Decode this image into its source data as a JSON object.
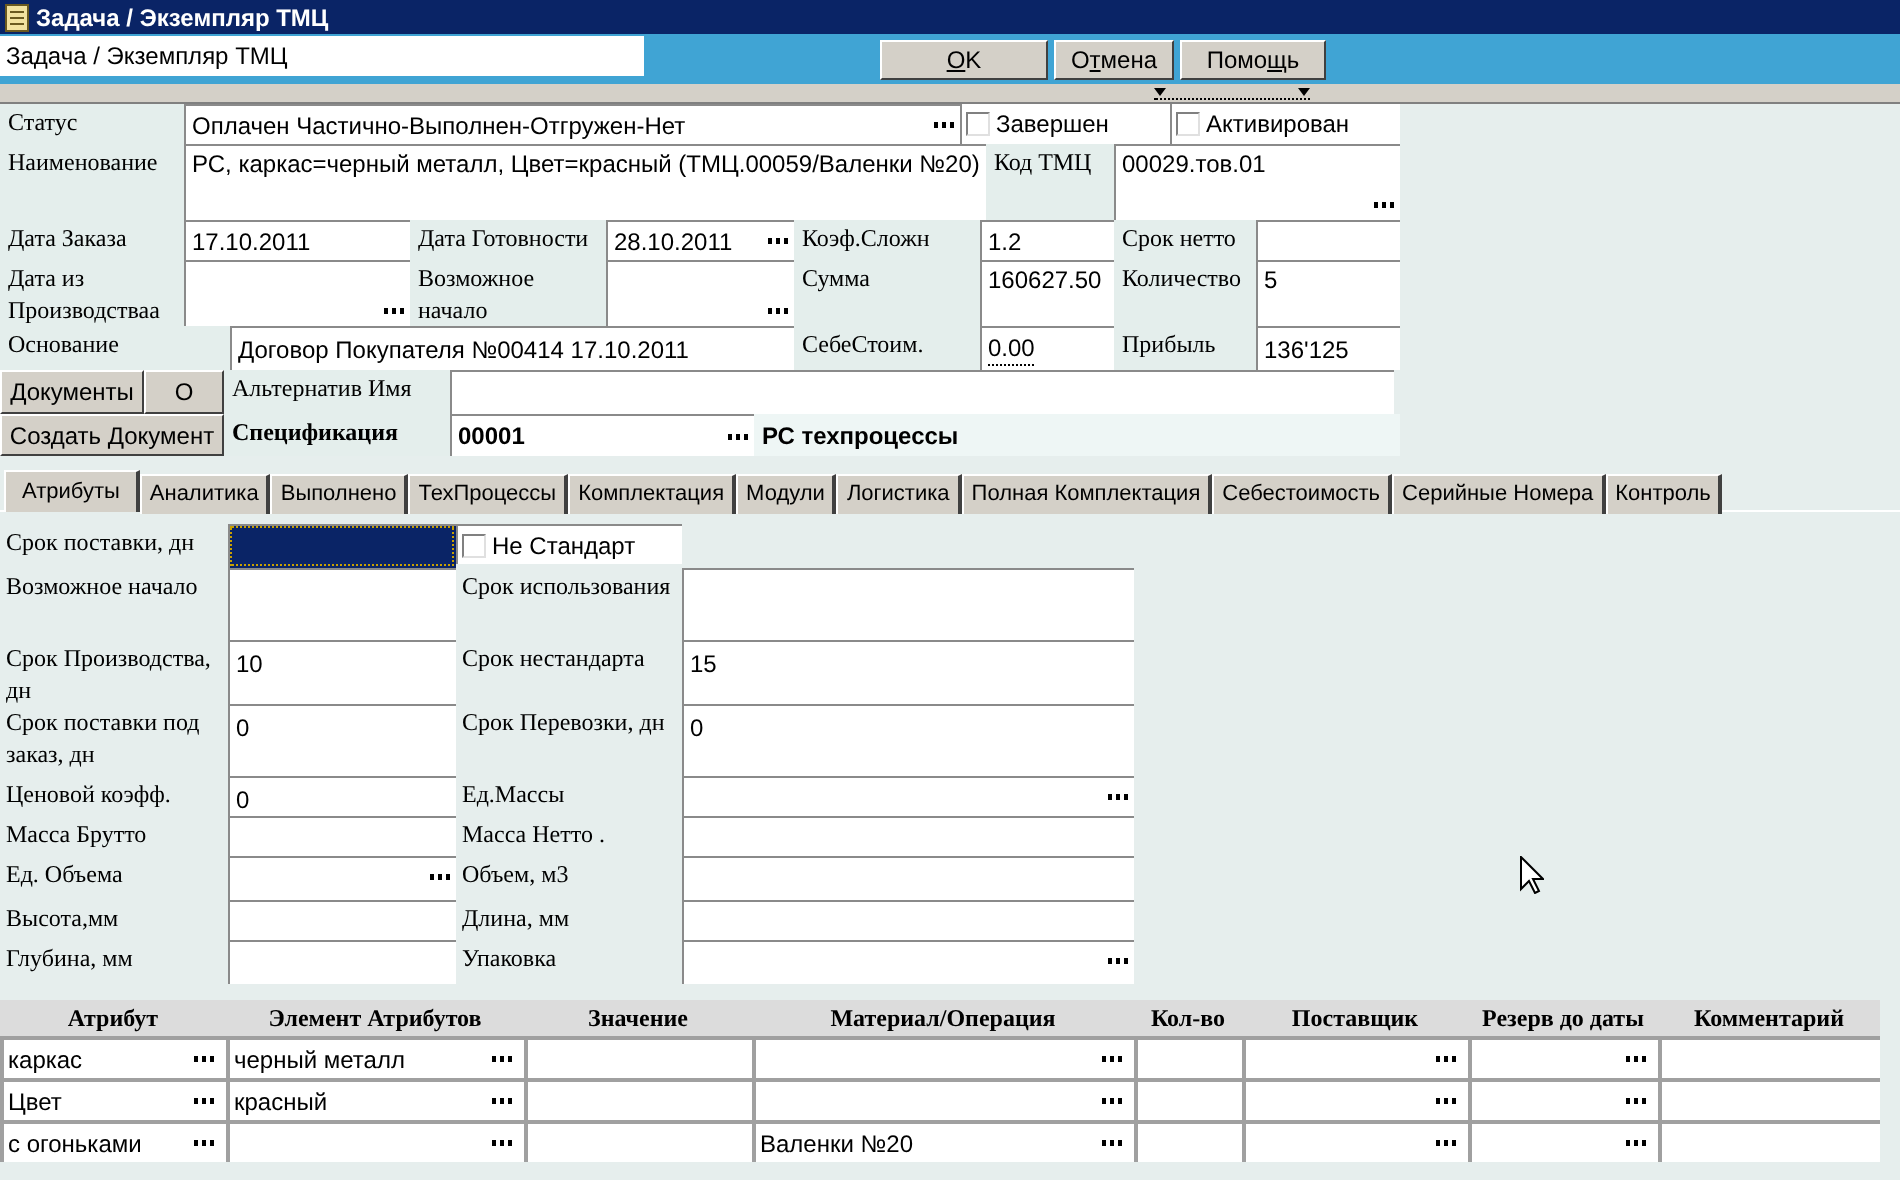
{
  "window": {
    "title": "Задача / Экземпляр ТМЦ"
  },
  "header_field": {
    "value": "Задача / Экземпляр ТМЦ"
  },
  "buttons": [
    {
      "key": "O",
      "post": "K"
    },
    {
      "pre": "О",
      "key": "т",
      "post": "мена"
    },
    {
      "pre": "Помо",
      "key": "щ",
      "post": "ь"
    }
  ],
  "form_rows": [
    {
      "cells": [
        {
          "kind": "label",
          "text": "Статус"
        },
        {
          "kind": "lookup",
          "value": "Оплачен Частично-Выполнен-Отгружен-Нет"
        },
        {
          "kind": "checkbox",
          "text": "Завершен",
          "checked": false
        },
        {
          "kind": "checkbox",
          "text": "Активирован",
          "checked": false
        }
      ]
    },
    {
      "cells": [
        {
          "kind": "label",
          "text": "Наименование"
        },
        {
          "kind": "field",
          "value": "РС, каркас=черный металл, Цвет=красный  (ТМЦ.00059/Валенки №20)"
        },
        {
          "kind": "label",
          "text": "Код ТМЦ"
        },
        {
          "kind": "lookup",
          "value": "00029.тов.01"
        }
      ]
    },
    {
      "cells": [
        {
          "kind": "label",
          "text": "Дата Заказа"
        },
        {
          "kind": "field",
          "value": "17.10.2011"
        },
        {
          "kind": "label",
          "text": "Дата Готовности"
        },
        {
          "kind": "lookup",
          "value": "28.10.2011"
        },
        {
          "kind": "label",
          "text": "Коэф.Сложн"
        },
        {
          "kind": "field",
          "value": "1.2"
        },
        {
          "kind": "label",
          "text": "Срок нетто"
        },
        {
          "kind": "field"
        }
      ]
    },
    {
      "cells": [
        {
          "kind": "label",
          "text": "Дата из Производстваа"
        },
        {
          "kind": "lookup"
        },
        {
          "kind": "label",
          "text": "Возможное начало"
        },
        {
          "kind": "lookup"
        },
        {
          "kind": "label",
          "text": "Сумма"
        },
        {
          "kind": "field",
          "value": "160627.50"
        },
        {
          "kind": "label",
          "text": "Количество"
        },
        {
          "kind": "field",
          "value": "5"
        }
      ]
    },
    {
      "cells": [
        {
          "kind": "label",
          "text": "Основание"
        },
        {
          "kind": "field",
          "value": "Договор Покупателя №00414 17.10.2011"
        },
        {
          "kind": "label",
          "text": "СебеСтоим."
        },
        {
          "kind": "dotted",
          "value": "0.00"
        },
        {
          "kind": "label",
          "text": "Прибыль"
        },
        {
          "kind": "field",
          "value": "136'125"
        }
      ]
    },
    {
      "cells": [
        {
          "kind": "button",
          "text": "Документы"
        },
        {
          "kind": "button",
          "text": "О"
        },
        {
          "kind": "label",
          "text": "Альтернатив Имя"
        },
        {
          "kind": "dotted"
        }
      ]
    },
    {
      "cells": [
        {
          "kind": "button",
          "text": "Создать Документ"
        },
        {
          "kind": "label",
          "text": "Спецификация",
          "bold": true
        },
        {
          "kind": "lookup",
          "value": "00001",
          "bold": true
        },
        {
          "kind": "caption",
          "text": "РС техпроцессы",
          "bold": true
        }
      ]
    }
  ],
  "tabs": [
    {
      "label": "Атрибуты",
      "selected": true
    },
    {
      "label": "Аналитика",
      "selected": false
    },
    {
      "label": "Выполнено",
      "selected": false
    },
    {
      "label": "ТехПроцессы",
      "selected": false
    },
    {
      "label": "Комплектация",
      "selected": false
    },
    {
      "label": "Модули",
      "selected": false
    },
    {
      "label": "Логистика",
      "selected": false
    },
    {
      "label": "Полная Комплектация",
      "selected": false
    },
    {
      "label": "Себестоимость",
      "selected": false
    },
    {
      "label": "Серийные Номера",
      "selected": false
    },
    {
      "label": "Контроль",
      "selected": false
    }
  ],
  "attributes": [
    {
      "left": {
        "label": "Срок поставки, дн",
        "kind": "field",
        "focused": true
      },
      "right": {
        "kind": "checkbox",
        "label": "Не Стандарт",
        "checked": false
      }
    },
    {
      "left": {
        "label": "Возможное начало",
        "kind": "field",
        "focused": false
      },
      "right": {
        "kind": "field",
        "label": "Срок использования"
      }
    },
    {
      "left": {
        "label": "Срок Производства, дн",
        "kind": "field",
        "value": "10",
        "focused": false
      },
      "right": {
        "kind": "field",
        "label": "Срок нестандарта",
        "value": "15"
      }
    },
    {
      "left": {
        "label": "Срок поставки под заказ, дн",
        "kind": "field",
        "value": "0",
        "focused": false
      },
      "right": {
        "kind": "field",
        "label": "Срок Перевозки, дн",
        "value": "0"
      }
    },
    {
      "left": {
        "label": "Ценовой коэфф.",
        "kind": "field",
        "value": "0",
        "focused": false
      },
      "right": {
        "kind": "lookup",
        "label": "Ед.Массы"
      }
    },
    {
      "left": {
        "label": "Масса Брутто",
        "kind": "field",
        "focused": false
      },
      "right": {
        "kind": "field",
        "label": "Масса Нетто ."
      }
    },
    {
      "left": {
        "label": "Ед. Объема",
        "kind": "lookup",
        "focused": false
      },
      "right": {
        "kind": "field",
        "label": "Объем, м3"
      }
    },
    {
      "left": {
        "label": "Высота,мм",
        "kind": "field",
        "focused": false
      },
      "right": {
        "kind": "field",
        "label": "Длина, мм"
      }
    },
    {
      "left": {
        "label": "Глубина, мм",
        "kind": "field",
        "focused": false
      },
      "right": {
        "kind": "lookup",
        "label": "Упаковка"
      }
    }
  ],
  "table": {
    "columns": [
      {
        "title": "Атрибут",
        "kind": "lookup"
      },
      {
        "title": "Элемент Атрибутов",
        "kind": "lookup"
      },
      {
        "title": "Значение",
        "kind": "plain"
      },
      {
        "title": "Материал/Операция",
        "kind": "lookup"
      },
      {
        "title": "Кол-во",
        "kind": "plain"
      },
      {
        "title": "Поставщик",
        "kind": "lookup"
      },
      {
        "title": "Резерв до даты",
        "kind": "lookup"
      },
      {
        "title": "Комментарий",
        "kind": "plain"
      }
    ],
    "rows": [
      {
        "cells": [
          {
            "text": "каркас"
          },
          {
            "text": "черный металл"
          },
          {},
          {},
          {},
          {},
          {},
          {}
        ]
      },
      {
        "cells": [
          {
            "text": "Цвет"
          },
          {
            "text": "красный"
          },
          {},
          {},
          {},
          {},
          {},
          {}
        ]
      },
      {
        "cells": [
          {
            "text": "с огоньками"
          },
          {},
          {},
          {
            "text": "Валенки №20"
          },
          {},
          {},
          {},
          {}
        ]
      }
    ]
  }
}
